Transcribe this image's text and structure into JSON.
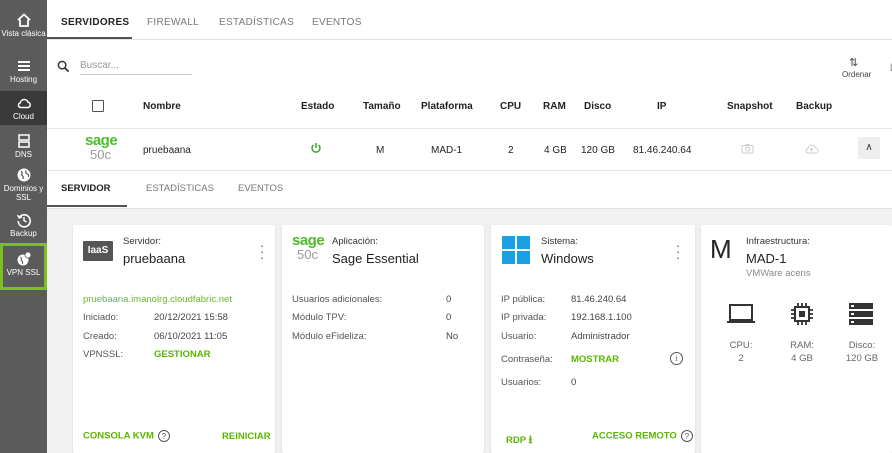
{
  "sidebar": {
    "items": [
      {
        "label": "Vista clásica",
        "icon": "home-icon"
      },
      {
        "label": "Hosting",
        "icon": "menu-lines-icon"
      },
      {
        "label": "Cloud",
        "icon": "cloud-icon"
      },
      {
        "label": "DNS",
        "icon": "server-icon"
      },
      {
        "label": "Dominios y SSL",
        "icon": "globe-icon"
      },
      {
        "label": "Backup",
        "icon": "history-icon"
      },
      {
        "label": "VPN SSL",
        "icon": "vpn-globe-icon"
      }
    ]
  },
  "tabs": [
    "SERVIDORES",
    "FIREWALL",
    "ESTADÍSTICAS",
    "EVENTOS"
  ],
  "search": {
    "placeholder": "Buscar..."
  },
  "sort": {
    "label": "Ordenar"
  },
  "table": {
    "headers": [
      "Nombre",
      "Estado",
      "Tamaño",
      "Plataforma",
      "CPU",
      "RAM",
      "Disco",
      "IP",
      "Snapshot",
      "Backup"
    ],
    "row": {
      "logo_word": "sage",
      "logo_sub": "50c",
      "name": "pruebaana",
      "size": "M",
      "platform": "MAD-1",
      "cpu": "2",
      "ram": "4 GB",
      "disk": "120 GB",
      "ip": "81.46.240.64"
    }
  },
  "subtabs": [
    "SERVIDOR",
    "ESTADÍSTICAS",
    "EVENTOS"
  ],
  "cards": {
    "server": {
      "badge": "IaaS",
      "label": "Servidor:",
      "title": "pruebaana",
      "url": "pruebaana.imanolrg.cloudfabric.net",
      "rows": [
        {
          "k": "Iniciado:",
          "v": "20/12/2021 15:58"
        },
        {
          "k": "Creado:",
          "v": "06/10/2021 11:05"
        },
        {
          "k": "VPNSSL:",
          "v": "GESTIONAR"
        }
      ],
      "footer_left": "CONSOLA KVM",
      "footer_right": "REINICIAR"
    },
    "app": {
      "logo_word": "sage",
      "logo_sub": "50c",
      "label": "Aplicación:",
      "title": "Sage Essential",
      "rows": [
        {
          "k": "Usuarios adicionales:",
          "v": "0"
        },
        {
          "k": "Módulo TPV:",
          "v": "0"
        },
        {
          "k": "Módulo eFideliza:",
          "v": "No"
        }
      ]
    },
    "system": {
      "label": "Sistema:",
      "title": "Windows",
      "rows": [
        {
          "k": "IP pública:",
          "v": "81.46.240.64"
        },
        {
          "k": "IP privada:",
          "v": "192.168.1.100"
        },
        {
          "k": "Usuario:",
          "v": "Administrador"
        },
        {
          "k": "Contraseña:",
          "v": "MOSTRAR"
        },
        {
          "k": "Usuarios:",
          "v": "0"
        }
      ],
      "footer_left": "RDP",
      "footer_right": "ACCESO REMOTO"
    },
    "infra": {
      "letter": "M",
      "label": "Infraestructura:",
      "title": "MAD-1",
      "subtitle": "VMWare acens",
      "items": [
        {
          "k": "CPU:",
          "v": "2"
        },
        {
          "k": "RAM:",
          "v": "4 GB"
        },
        {
          "k": "Disco:",
          "v": "120 GB"
        }
      ]
    }
  },
  "colors": {
    "accent": "#5ab500",
    "sidebar": "#5b5b5b",
    "highlight": "#7dc01d",
    "power": "#3da52b"
  }
}
